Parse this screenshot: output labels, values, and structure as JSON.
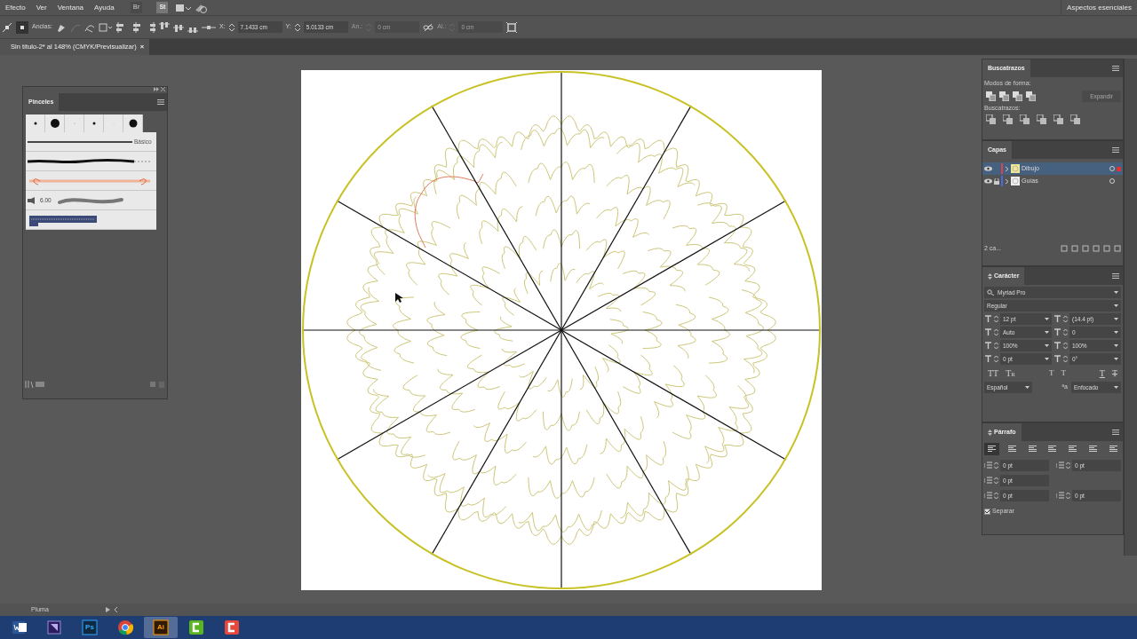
{
  "menu": [
    {
      "label": "Efecto"
    },
    {
      "label": "Ver"
    },
    {
      "label": "Ventana"
    },
    {
      "label": "Ayuda"
    }
  ],
  "app_buttons": [
    {
      "label": "Br",
      "disabled": true
    },
    {
      "label": "St",
      "disabled": false
    }
  ],
  "workspace": "Aspectos esenciales",
  "control_bar": {
    "anchors_label": "Anclas:",
    "fields": [
      {
        "label": "X:",
        "value": "7.1433 cm",
        "disabled": false
      },
      {
        "label": "Y:",
        "value": "5.0133 cm",
        "disabled": false
      },
      {
        "label": "An.:",
        "value": "0 cm",
        "disabled": true
      },
      {
        "label": "Al.:",
        "value": "0 cm",
        "disabled": true
      }
    ]
  },
  "document_tab": {
    "title": "Sin título-2* al 148% (CMYK/Previsualizar)",
    "close": "×"
  },
  "brushes_panel": {
    "title": "Pinceles",
    "basic_label": "Básico",
    "size": "6.00"
  },
  "pathfinder_panel": {
    "title": "Buscatrazos",
    "shape_modes_label": "Modos de forma:",
    "expand_button": "Expandir",
    "pathfinders_label": "Buscatrazos:"
  },
  "layers_panel": {
    "title": "Capas",
    "count": "2 ca...",
    "layers": [
      {
        "name": "Dibujo",
        "selected": true,
        "locked": false,
        "color": "#d9434f"
      },
      {
        "name": "Guías",
        "selected": false,
        "locked": true,
        "color": "#4a6ae0"
      }
    ]
  },
  "character_panel": {
    "title": "Carácter",
    "font": "Myriad Pro",
    "style": "Regular",
    "fields": [
      {
        "value": "12 pt"
      },
      {
        "value": "(14.4 pt)"
      },
      {
        "value": "Auto"
      },
      {
        "value": "0"
      },
      {
        "value": "100%"
      },
      {
        "value": "100%"
      },
      {
        "value": "0 pt"
      },
      {
        "value": "0°"
      }
    ],
    "type_buttons": [
      {
        "label": "TT",
        "kind": "caps"
      },
      {
        "label": "Tr",
        "kind": "smallcaps"
      },
      {
        "label": "T",
        "kind": "super"
      },
      {
        "label": "T",
        "kind": "sub"
      },
      {
        "label": "T",
        "kind": "underline"
      },
      {
        "label": "T",
        "kind": "strike"
      }
    ],
    "language": "Español",
    "antialias_symbol": "ªa",
    "antialias": "Enfocado"
  },
  "paragraph_panel": {
    "title": "Párrafo",
    "alignments": [
      {
        "selected": true
      },
      {
        "selected": false
      },
      {
        "selected": false
      },
      {
        "selected": false
      },
      {
        "selected": false
      },
      {
        "selected": false
      },
      {
        "selected": false
      }
    ],
    "fields": [
      {
        "value": "0 pt"
      },
      {
        "value": "0 pt"
      },
      {
        "value": "0 pt"
      },
      {
        "value": "0 pt"
      },
      {
        "value": "0 pt"
      }
    ],
    "hyphenate": {
      "label": "Separar",
      "checked": true
    }
  },
  "status_bar": {
    "tool": "Pluma"
  },
  "taskbar": [
    {
      "kind": "word",
      "selected": false
    },
    {
      "kind": "premiere",
      "selected": false
    },
    {
      "kind": "photoshop",
      "label": "Ps",
      "selected": false
    },
    {
      "kind": "chrome",
      "selected": false
    },
    {
      "kind": "illustrator",
      "label": "Ai",
      "selected": true
    },
    {
      "kind": "camtasia",
      "selected": false
    },
    {
      "kind": "recorder",
      "selected": false
    }
  ]
}
